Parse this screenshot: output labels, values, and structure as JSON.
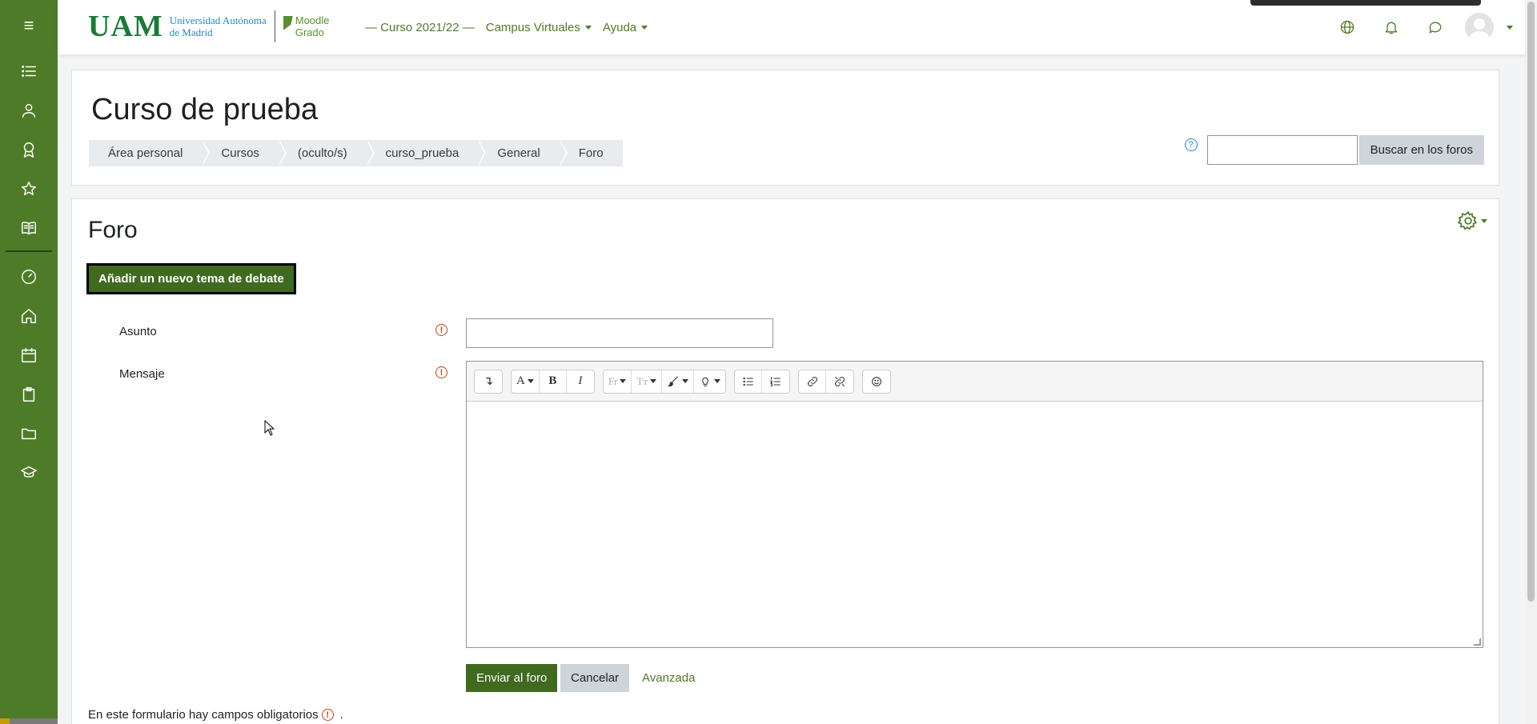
{
  "rail": {
    "menu_icon": "≡",
    "items": [
      {
        "name": "list-icon"
      },
      {
        "name": "user-group-icon"
      },
      {
        "name": "badge-icon"
      },
      {
        "name": "star-icon"
      },
      {
        "name": "book-icon"
      },
      {
        "name": "dashboard-icon"
      },
      {
        "name": "home-icon"
      },
      {
        "name": "calendar-icon"
      },
      {
        "name": "clipboard-icon"
      },
      {
        "name": "folder-icon"
      },
      {
        "name": "graduation-cap-icon"
      }
    ]
  },
  "navbar": {
    "logo_uam": "UAM",
    "logo_uni_line1": "Universidad Autónoma",
    "logo_uni_line2": "de Madrid",
    "logo_moodle_line1": "Moodle",
    "logo_moodle_line2": "Grado",
    "course_year": "— Curso 2021/22 —",
    "campus": "Campus Virtuales",
    "help": "Ayuda"
  },
  "header": {
    "title": "Curso de prueba",
    "breadcrumb": [
      "Área personal",
      "Cursos",
      "(oculto/s)",
      "curso_prueba",
      "General",
      "Foro"
    ],
    "help_icon": "?",
    "search_button": "Buscar en los foros"
  },
  "main": {
    "forum_title": "Foro",
    "add_topic_button": "Añadir un nuevo tema de debate",
    "subject_label": "Asunto",
    "message_label": "Mensaje",
    "required_icon": "!",
    "submit_button": "Enviar al foro",
    "cancel_button": "Cancelar",
    "advanced_link": "Avanzada",
    "required_note": "En este formulario hay campos obligatorios",
    "required_note_end": "."
  },
  "toolbar": {
    "collapse": "↴",
    "font_color": "A",
    "bold": "B",
    "italic": "I",
    "font_family": "Fr",
    "font_size": "Tт"
  },
  "colors": {
    "brand_green": "#4e7b27",
    "button_green": "#3f6a1f",
    "required_orange": "#c1440e"
  }
}
